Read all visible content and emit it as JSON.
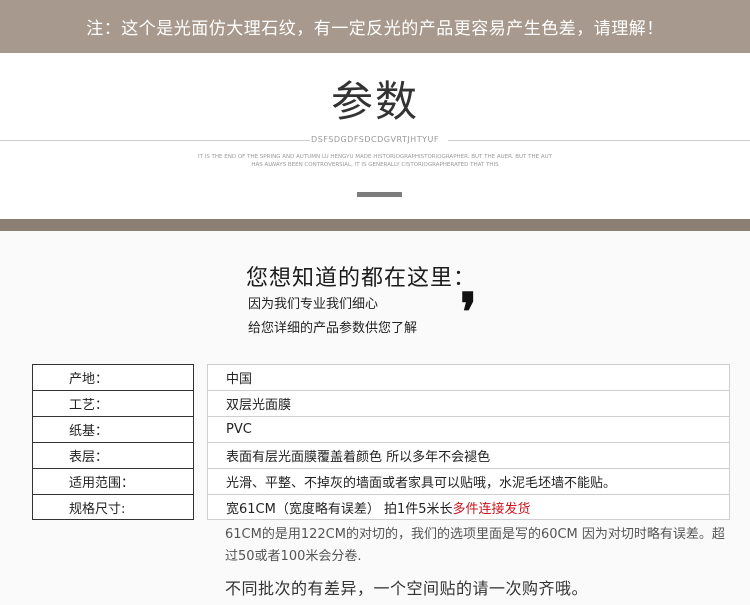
{
  "notice": "注：这个是光面仿大理石纹，有一定反光的产品更容易产生色差，请理解！",
  "title": {
    "main": "参数",
    "sub_code": "DSFSDGDFSDCDGVRTJHTYUF",
    "small_line1": "IT IS THE END OF THE SPRING AND AUTUMN LU HENGYU MADE HISTORIOGRAPHISTORIOGRAPHER. BUT THE AUER. BUT THE AUT",
    "small_line2": "HAS ALWAYS BEEN CONTROVERSIAL, IT IS GENERALLY CISTORIOGRAPHERATED THAT THIS"
  },
  "want": {
    "title": "您想知道的都在这里：",
    "line1": "因为我们专业我们细心",
    "line2": "给您详细的产品参数供您了解",
    "quote_mark": "❜"
  },
  "specs": {
    "rows": [
      {
        "label": "产地：",
        "value": "中国"
      },
      {
        "label": "工艺：",
        "value": "双层光面膜"
      },
      {
        "label": "纸基：",
        "value": "PVC"
      },
      {
        "label": "表层：",
        "value": "表面有层光面膜覆盖着颜色 所以多年不会褪色"
      },
      {
        "label": "适用范围：",
        "value": "光滑、平整、不掉灰的墙面或者家具可以贴哦，水泥毛坯墙不能贴。"
      },
      {
        "label": "规格尺寸:",
        "value_normal": "宽61CM（宽度略有误差） 拍1件5米长 ",
        "value_red": "多件连接发货"
      }
    ]
  },
  "notes": {
    "line1": "61CM的是用122CM的对切的，我们的选项里面是写的60CM 因为对切时略有误差。超过50或者100米会分卷.",
    "line2": "不同批次的有差异，一个空间贴的请一次购齐哦。"
  },
  "colors": {
    "notice_bg": "#a8998e",
    "divider_band": "#8b7e72",
    "accent_red": "#c8161d"
  }
}
